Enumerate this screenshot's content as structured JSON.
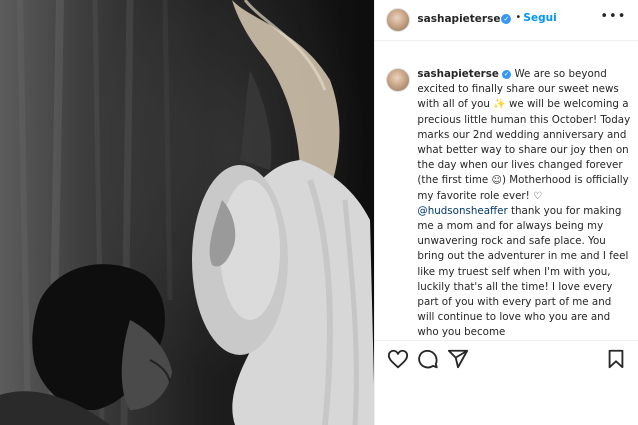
{
  "header": {
    "username": "sashapieterse",
    "follow_label": "Segui",
    "separator": "•",
    "more_label": "•••",
    "verified_mark": "✓"
  },
  "caption": {
    "username": "sashapieterse",
    "verified_mark": "✓",
    "part1": "We are so beyond excited to finally share our sweet news with all of you",
    "emoji_sparkles": "✨",
    "part2": "we will be welcoming a precious little human this October! Today marks our 2nd wedding anniversary and what better way to share our joy then on the day when our lives changed forever (the first time",
    "emoji_smile": "☺",
    "part3": ") Motherhood is officially my favorite role ever!",
    "emoji_heart": "♡",
    "mention": "@hudsonsheaffer",
    "part4": "thank you for making me a mom and for always being my unwavering rock and safe place. You bring out the adventurer in me and I feel like my truest self when I'm with you, luckily that's all the time! I love every part of you with every part of me and will continue to love who you are and who you become"
  },
  "actions": {
    "like_icon": "heart-outline-icon",
    "comment_icon": "comment-icon",
    "share_icon": "paper-plane-icon",
    "save_icon": "bookmark-icon"
  },
  "colors": {
    "link_blue": "#0095f6",
    "verified_blue": "#3897f0",
    "mention": "#00376b",
    "text": "#262626",
    "divider": "#efefef"
  }
}
